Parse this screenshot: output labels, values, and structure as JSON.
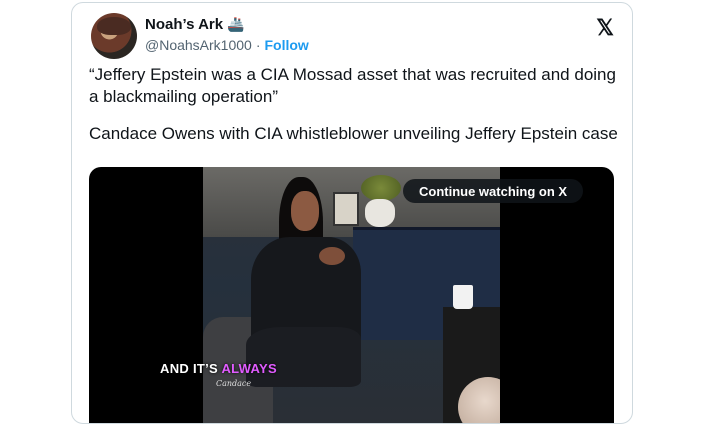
{
  "author": {
    "name": "Noah’s Ark",
    "badge_icon": "ship-emoji",
    "handle": "@NoahsArk1000",
    "separator": "·",
    "follow_label": "Follow"
  },
  "platform_logo": "𝕏",
  "tweet": {
    "paragraph1": "“Jeffery Epstein was a CIA Mossad asset that was recruited and doing a blackmailing operation”",
    "paragraph2": "Candace Owens with CIA whistleblower unveiling Jeffery Epstein case"
  },
  "media": {
    "continue_label": "Continue watching on X",
    "caption_plain": "AND IT’S ",
    "caption_accent": "ALWAYS",
    "caption_accent_color": "#e05bff",
    "watermark": "Candace"
  },
  "colors": {
    "accent": "#1d9bf0",
    "text": "#0f1419",
    "secondary": "#536471"
  }
}
